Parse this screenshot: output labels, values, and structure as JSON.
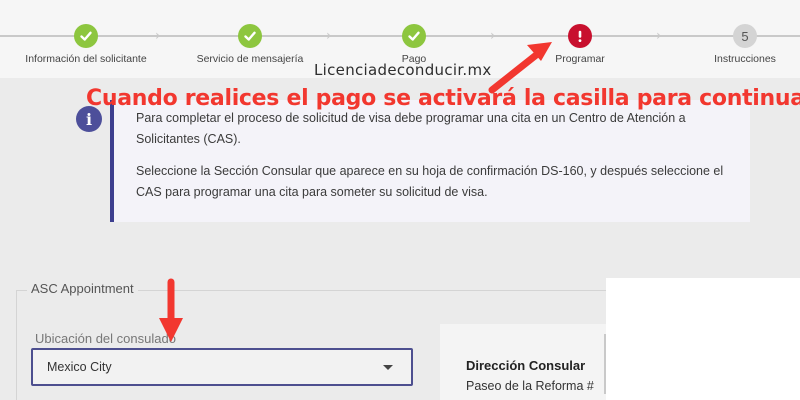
{
  "stepper": {
    "steps": [
      {
        "label": "Información del solicitante",
        "state": "done",
        "icon": "check-icon"
      },
      {
        "label": "Servicio de mensajería",
        "state": "done",
        "icon": "check-icon"
      },
      {
        "label": "Pago",
        "state": "done",
        "icon": "check-icon"
      },
      {
        "label": "Programar",
        "state": "current-alert",
        "icon": "exclamation-icon"
      },
      {
        "label": "Instrucciones",
        "state": "pending",
        "number": "5"
      }
    ]
  },
  "watermark": "Licenciadeconducir.mx",
  "overlay_caption": "Cuando realices el pago se activará la casilla para continuar",
  "info": {
    "icon": "info-icon",
    "paragraph1": "Para completar el proceso de solicitud de visa debe programar una cita en un Centro de Atención a Solicitantes (CAS).",
    "paragraph2": "Seleccione la Sección Consular que aparece en su hoja de confirmación DS-160, y después seleccione el CAS para programar una cita para someter su solicitud de visa."
  },
  "asc": {
    "legend": "ASC Appointment",
    "consulate_label": "Ubicación del consulado",
    "consulate_value": "Mexico City"
  },
  "direccion": {
    "title": "Dirección Consular",
    "address": "Paseo de la Reforma #"
  },
  "colors": {
    "done": "#8dc63f",
    "alert": "#c8102e",
    "annotation_red": "#f2372f",
    "accent": "#3d3f8f"
  }
}
